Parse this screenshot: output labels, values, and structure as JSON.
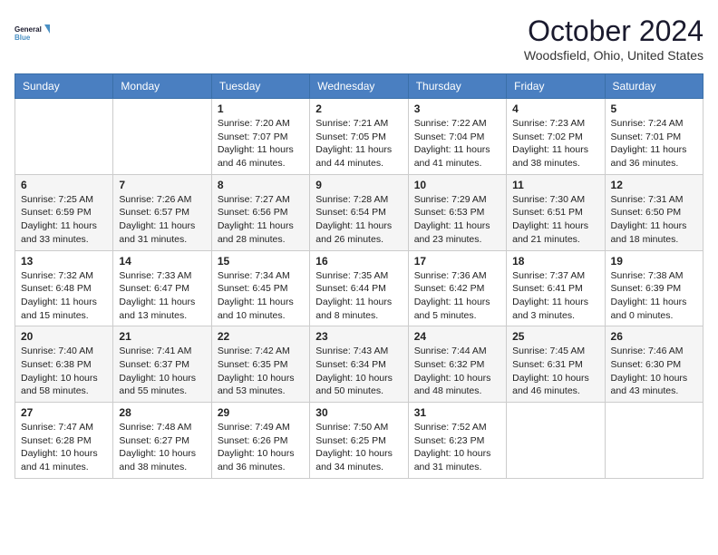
{
  "header": {
    "logo_line1": "General",
    "logo_line2": "Blue",
    "month_title": "October 2024",
    "location": "Woodsfield, Ohio, United States"
  },
  "weekdays": [
    "Sunday",
    "Monday",
    "Tuesday",
    "Wednesday",
    "Thursday",
    "Friday",
    "Saturday"
  ],
  "weeks": [
    [
      {
        "day": "",
        "sunrise": "",
        "sunset": "",
        "daylight": ""
      },
      {
        "day": "",
        "sunrise": "",
        "sunset": "",
        "daylight": ""
      },
      {
        "day": "1",
        "sunrise": "Sunrise: 7:20 AM",
        "sunset": "Sunset: 7:07 PM",
        "daylight": "Daylight: 11 hours and 46 minutes."
      },
      {
        "day": "2",
        "sunrise": "Sunrise: 7:21 AM",
        "sunset": "Sunset: 7:05 PM",
        "daylight": "Daylight: 11 hours and 44 minutes."
      },
      {
        "day": "3",
        "sunrise": "Sunrise: 7:22 AM",
        "sunset": "Sunset: 7:04 PM",
        "daylight": "Daylight: 11 hours and 41 minutes."
      },
      {
        "day": "4",
        "sunrise": "Sunrise: 7:23 AM",
        "sunset": "Sunset: 7:02 PM",
        "daylight": "Daylight: 11 hours and 38 minutes."
      },
      {
        "day": "5",
        "sunrise": "Sunrise: 7:24 AM",
        "sunset": "Sunset: 7:01 PM",
        "daylight": "Daylight: 11 hours and 36 minutes."
      }
    ],
    [
      {
        "day": "6",
        "sunrise": "Sunrise: 7:25 AM",
        "sunset": "Sunset: 6:59 PM",
        "daylight": "Daylight: 11 hours and 33 minutes."
      },
      {
        "day": "7",
        "sunrise": "Sunrise: 7:26 AM",
        "sunset": "Sunset: 6:57 PM",
        "daylight": "Daylight: 11 hours and 31 minutes."
      },
      {
        "day": "8",
        "sunrise": "Sunrise: 7:27 AM",
        "sunset": "Sunset: 6:56 PM",
        "daylight": "Daylight: 11 hours and 28 minutes."
      },
      {
        "day": "9",
        "sunrise": "Sunrise: 7:28 AM",
        "sunset": "Sunset: 6:54 PM",
        "daylight": "Daylight: 11 hours and 26 minutes."
      },
      {
        "day": "10",
        "sunrise": "Sunrise: 7:29 AM",
        "sunset": "Sunset: 6:53 PM",
        "daylight": "Daylight: 11 hours and 23 minutes."
      },
      {
        "day": "11",
        "sunrise": "Sunrise: 7:30 AM",
        "sunset": "Sunset: 6:51 PM",
        "daylight": "Daylight: 11 hours and 21 minutes."
      },
      {
        "day": "12",
        "sunrise": "Sunrise: 7:31 AM",
        "sunset": "Sunset: 6:50 PM",
        "daylight": "Daylight: 11 hours and 18 minutes."
      }
    ],
    [
      {
        "day": "13",
        "sunrise": "Sunrise: 7:32 AM",
        "sunset": "Sunset: 6:48 PM",
        "daylight": "Daylight: 11 hours and 15 minutes."
      },
      {
        "day": "14",
        "sunrise": "Sunrise: 7:33 AM",
        "sunset": "Sunset: 6:47 PM",
        "daylight": "Daylight: 11 hours and 13 minutes."
      },
      {
        "day": "15",
        "sunrise": "Sunrise: 7:34 AM",
        "sunset": "Sunset: 6:45 PM",
        "daylight": "Daylight: 11 hours and 10 minutes."
      },
      {
        "day": "16",
        "sunrise": "Sunrise: 7:35 AM",
        "sunset": "Sunset: 6:44 PM",
        "daylight": "Daylight: 11 hours and 8 minutes."
      },
      {
        "day": "17",
        "sunrise": "Sunrise: 7:36 AM",
        "sunset": "Sunset: 6:42 PM",
        "daylight": "Daylight: 11 hours and 5 minutes."
      },
      {
        "day": "18",
        "sunrise": "Sunrise: 7:37 AM",
        "sunset": "Sunset: 6:41 PM",
        "daylight": "Daylight: 11 hours and 3 minutes."
      },
      {
        "day": "19",
        "sunrise": "Sunrise: 7:38 AM",
        "sunset": "Sunset: 6:39 PM",
        "daylight": "Daylight: 11 hours and 0 minutes."
      }
    ],
    [
      {
        "day": "20",
        "sunrise": "Sunrise: 7:40 AM",
        "sunset": "Sunset: 6:38 PM",
        "daylight": "Daylight: 10 hours and 58 minutes."
      },
      {
        "day": "21",
        "sunrise": "Sunrise: 7:41 AM",
        "sunset": "Sunset: 6:37 PM",
        "daylight": "Daylight: 10 hours and 55 minutes."
      },
      {
        "day": "22",
        "sunrise": "Sunrise: 7:42 AM",
        "sunset": "Sunset: 6:35 PM",
        "daylight": "Daylight: 10 hours and 53 minutes."
      },
      {
        "day": "23",
        "sunrise": "Sunrise: 7:43 AM",
        "sunset": "Sunset: 6:34 PM",
        "daylight": "Daylight: 10 hours and 50 minutes."
      },
      {
        "day": "24",
        "sunrise": "Sunrise: 7:44 AM",
        "sunset": "Sunset: 6:32 PM",
        "daylight": "Daylight: 10 hours and 48 minutes."
      },
      {
        "day": "25",
        "sunrise": "Sunrise: 7:45 AM",
        "sunset": "Sunset: 6:31 PM",
        "daylight": "Daylight: 10 hours and 46 minutes."
      },
      {
        "day": "26",
        "sunrise": "Sunrise: 7:46 AM",
        "sunset": "Sunset: 6:30 PM",
        "daylight": "Daylight: 10 hours and 43 minutes."
      }
    ],
    [
      {
        "day": "27",
        "sunrise": "Sunrise: 7:47 AM",
        "sunset": "Sunset: 6:28 PM",
        "daylight": "Daylight: 10 hours and 41 minutes."
      },
      {
        "day": "28",
        "sunrise": "Sunrise: 7:48 AM",
        "sunset": "Sunset: 6:27 PM",
        "daylight": "Daylight: 10 hours and 38 minutes."
      },
      {
        "day": "29",
        "sunrise": "Sunrise: 7:49 AM",
        "sunset": "Sunset: 6:26 PM",
        "daylight": "Daylight: 10 hours and 36 minutes."
      },
      {
        "day": "30",
        "sunrise": "Sunrise: 7:50 AM",
        "sunset": "Sunset: 6:25 PM",
        "daylight": "Daylight: 10 hours and 34 minutes."
      },
      {
        "day": "31",
        "sunrise": "Sunrise: 7:52 AM",
        "sunset": "Sunset: 6:23 PM",
        "daylight": "Daylight: 10 hours and 31 minutes."
      },
      {
        "day": "",
        "sunrise": "",
        "sunset": "",
        "daylight": ""
      },
      {
        "day": "",
        "sunrise": "",
        "sunset": "",
        "daylight": ""
      }
    ]
  ]
}
